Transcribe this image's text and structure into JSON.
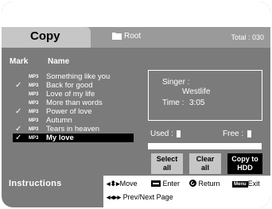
{
  "header": {
    "title": "Copy",
    "folder": "Root",
    "total": "Total : 030"
  },
  "columns": {
    "mark": "Mark",
    "name": "Name"
  },
  "tracks": [
    {
      "checked": false,
      "type": "MP3",
      "title": "Something like you",
      "selected": false
    },
    {
      "checked": true,
      "type": "MP3",
      "title": "Back for good",
      "selected": false
    },
    {
      "checked": false,
      "type": "MP3",
      "title": "Love of my life",
      "selected": false
    },
    {
      "checked": false,
      "type": "MP3",
      "title": "More than words",
      "selected": false
    },
    {
      "checked": true,
      "type": "MP3",
      "title": "Power of love",
      "selected": false
    },
    {
      "checked": false,
      "type": "MP3",
      "title": "Autumn",
      "selected": false
    },
    {
      "checked": true,
      "type": "MP3",
      "title": "Tears in heaven",
      "selected": false
    },
    {
      "checked": true,
      "type": "MP3",
      "title": "My love",
      "selected": true
    }
  ],
  "check_mark": "✓",
  "info": {
    "singer_label": "Singer :",
    "singer_value": "Westlife",
    "time_label": "Time :",
    "time_value": "3:05"
  },
  "capacity": {
    "used_label": "Used :",
    "free_label": "Free :"
  },
  "buttons": {
    "select_all": [
      "Select",
      "all"
    ],
    "clear_all": [
      "Clear",
      "all"
    ],
    "copy_to_hdd": [
      "Copy to",
      "HDD"
    ]
  },
  "instructions": {
    "label": "Instructions",
    "move_key": "◂⬍▸",
    "move": "Move",
    "enter": "Enter",
    "return": "Return",
    "menu_key": "Menu",
    "exit": "Exit",
    "page_key": "◂◂▸▸",
    "prev_next": "Prev/Next Page"
  },
  "colors": {
    "background": "#7b7b7b",
    "header_band": "#9a9a9a",
    "tab": "#c6c6c6",
    "selected_row": "#000000",
    "text": "#ffffff"
  }
}
